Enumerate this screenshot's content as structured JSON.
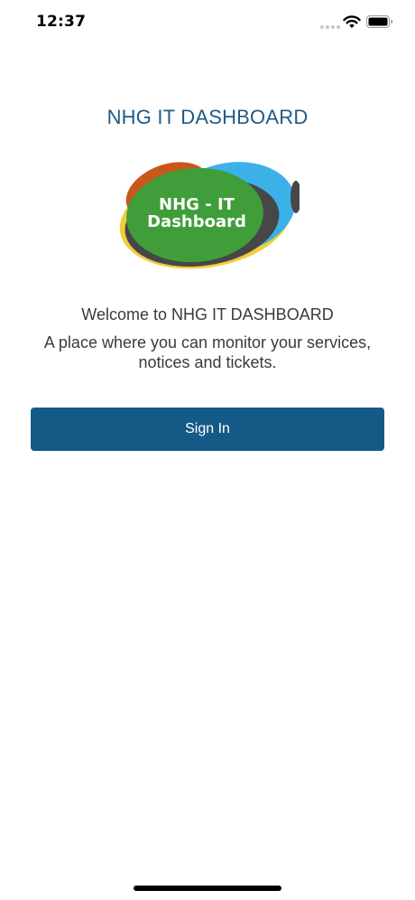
{
  "status_bar": {
    "time": "12:37",
    "icons": [
      "cellular-signal-icon",
      "wifi-icon",
      "battery-icon"
    ]
  },
  "app": {
    "title": "NHG IT DASHBOARD"
  },
  "logo": {
    "line1": "NHG - IT",
    "line2": "Dashboard",
    "colors": {
      "yellow": "#f0cd3c",
      "blue": "#3bb1e8",
      "dark": "#474747",
      "green": "#3f9e3a",
      "orange": "#c9571d"
    }
  },
  "welcome": {
    "heading": "Welcome to NHG IT DASHBOARD",
    "line1": "A place where you can monitor your services,",
    "line2": "notices and tickets."
  },
  "actions": {
    "sign_in_label": "Sign In"
  },
  "theme": {
    "primary": "#155a87",
    "title_color": "#1f5b85",
    "text_color": "#3a3a3a"
  }
}
